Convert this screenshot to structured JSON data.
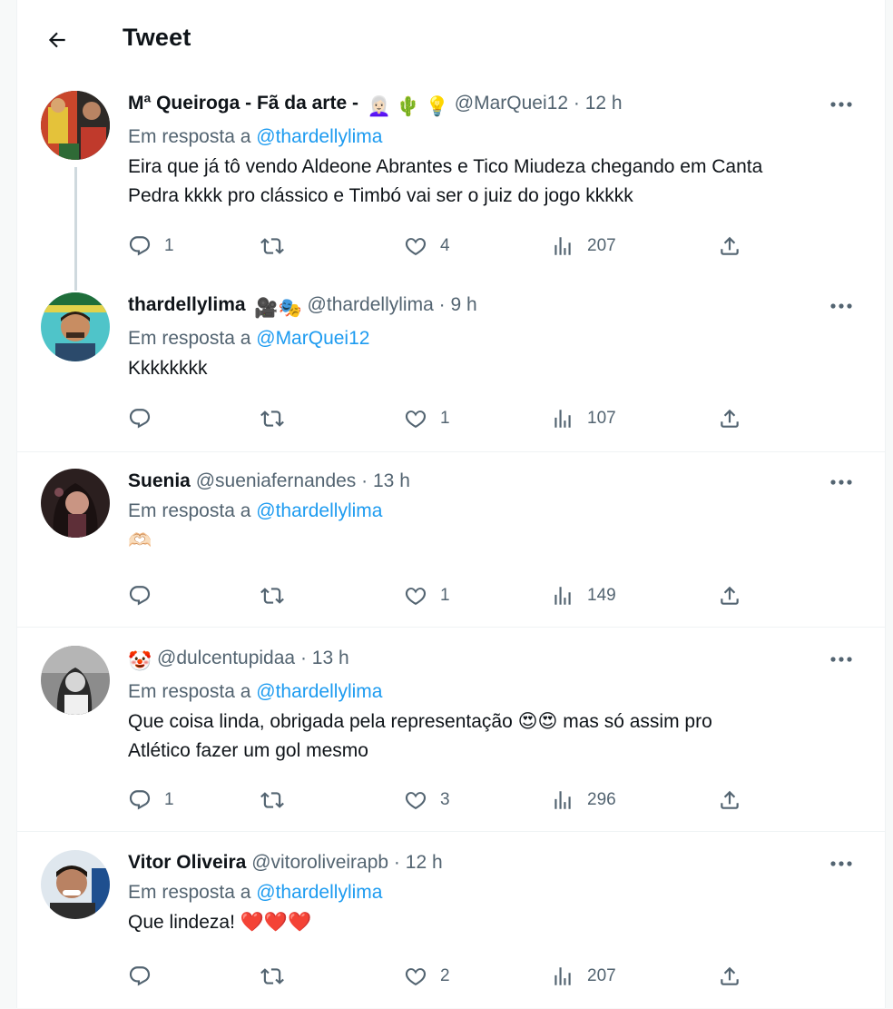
{
  "header": {
    "title": "Tweet"
  },
  "tweets": [
    {
      "name": "Mª Queiroga - Fã da arte -",
      "name_emoji": "👩🏻‍🦳 🌵 💡",
      "handle": "@MarQuei12",
      "time": "12 h",
      "reply_prefix": "Em resposta a",
      "reply_to": "@thardellylima",
      "text_lines": [
        "Eira que já tô vendo Aldeone Abrantes e Tico Miudeza chegando em Canta",
        "Pedra kkkk pro clássico e Timbó vai ser o juiz do jogo kkkkk"
      ],
      "replies": "1",
      "retweets": "",
      "likes": "4",
      "views": "207"
    },
    {
      "name": "thardellylima",
      "name_emoji": "🎥🎭",
      "handle": "@thardellylima",
      "time": "9 h",
      "reply_prefix": "Em resposta a",
      "reply_to": "@MarQuei12",
      "text_lines": [
        "Kkkkkkkk"
      ],
      "replies": "",
      "retweets": "",
      "likes": "1",
      "views": "107"
    },
    {
      "name": "Suenia",
      "name_emoji": "",
      "handle": "@sueniafernandes",
      "time": "13 h",
      "reply_prefix": "Em resposta a",
      "reply_to": "@thardellylima",
      "text_lines": [
        "🫶🏻"
      ],
      "replies": "",
      "retweets": "",
      "likes": "1",
      "views": "149"
    },
    {
      "name": "",
      "name_emoji": "🤡",
      "handle": "@dulcentupidaa",
      "time": "13 h",
      "reply_prefix": "Em resposta a",
      "reply_to": "@thardellylima",
      "text_lines": [
        "Que coisa linda, obrigada pela representação 😍😍 mas só assim pro",
        "Atlético fazer um gol mesmo"
      ],
      "replies": "1",
      "retweets": "",
      "likes": "3",
      "views": "296"
    },
    {
      "name": "Vitor Oliveira",
      "name_emoji": "",
      "handle": "@vitoroliveirapb",
      "time": "12 h",
      "reply_prefix": "Em resposta a",
      "reply_to": "@thardellylima",
      "text_lines": [
        "Que lindeza! ❤️❤️❤️"
      ],
      "replies": "",
      "retweets": "",
      "likes": "2",
      "views": "207"
    }
  ],
  "separator": "·",
  "icons": {
    "back": "arrow-left-icon",
    "more": "more-dots-icon",
    "reply": "reply-bubble-icon",
    "retweet": "retweet-icon",
    "like": "heart-icon",
    "views": "views-bars-icon",
    "share": "share-upload-icon"
  },
  "colors": {
    "mention": "#1d9bf0",
    "muted": "#536471",
    "text": "#0f1419",
    "thread_line": "#cfd9de"
  }
}
